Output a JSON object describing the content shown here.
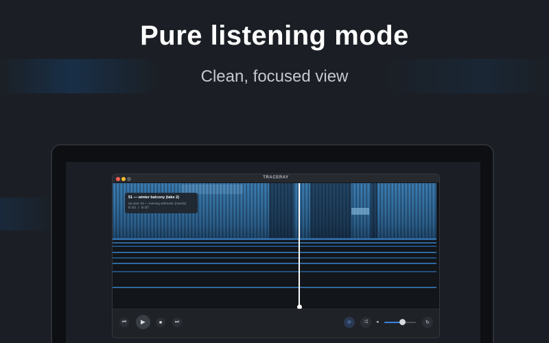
{
  "hero": {
    "headline": "Pure listening mode",
    "subheadline": "Clean, focused view"
  },
  "window": {
    "title": "TRACERAY"
  },
  "now_playing": {
    "track_title": "51 — winter balcony (take 2)",
    "up_next": "Up next: 52 — evening arithmetic (rework)",
    "time": "0:03 / 0:07"
  },
  "playhead": {
    "position_fraction": 0.57
  },
  "controls": {
    "previous_icon": "⏮",
    "play_icon": "▶",
    "stop_icon": "■",
    "next_icon": "⏭",
    "repeat_icon": "⟳",
    "shuffle_icon": "⤮",
    "volume_icon": "◂",
    "loop_icon": "↻"
  },
  "volume": {
    "level_fraction": 0.58
  },
  "colors": {
    "accent": "#3b82e0",
    "spectrogram": "#3d7fb4",
    "background": "#1b1f25"
  }
}
